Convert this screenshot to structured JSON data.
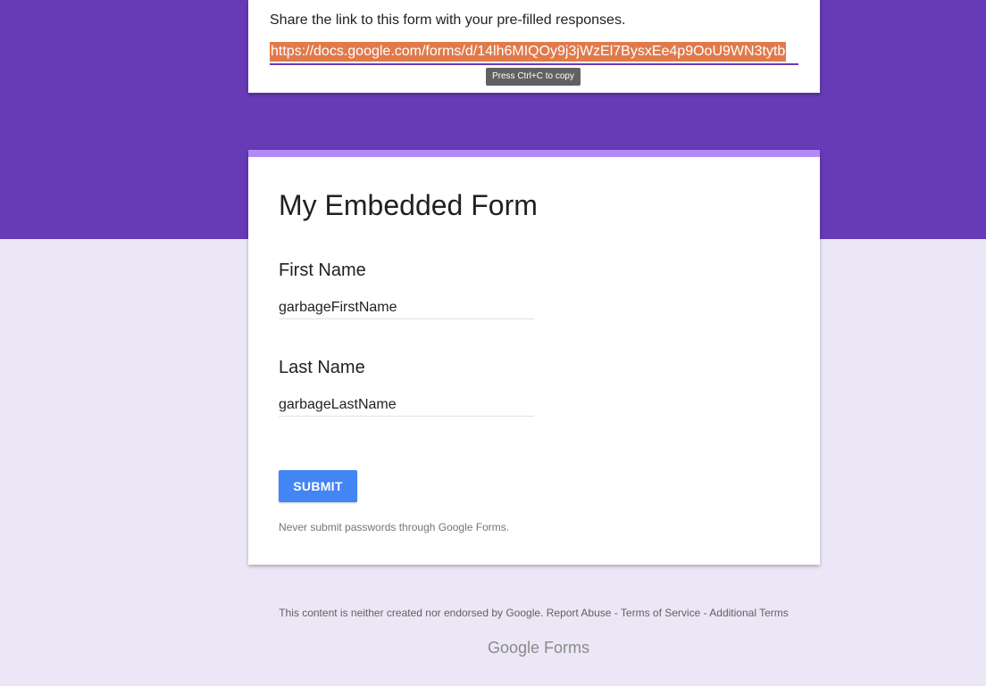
{
  "share": {
    "instruction": "Share the link to this form with your pre-filled responses.",
    "link": "https://docs.google.com/forms/d/14lh6MIQOy9j3jWzEl7BysxEe4p9OoU9WN3tytb",
    "tooltip": "Press Ctrl+C to copy"
  },
  "form": {
    "title": "My Embedded Form",
    "questions": [
      {
        "label": "First Name",
        "value": "garbageFirstName"
      },
      {
        "label": "Last Name",
        "value": "garbageLastName"
      }
    ],
    "submit_label": "SUBMIT",
    "warning": "Never submit passwords through Google Forms."
  },
  "footer": {
    "disclaimer": "This content is neither created nor endorsed by Google.",
    "links": [
      "Report Abuse",
      "Terms of Service",
      "Additional Terms"
    ],
    "separator": " - "
  },
  "brand": {
    "name": "Google Forms"
  },
  "colors": {
    "header_band": "#673ab7",
    "page_background": "#ece7f6",
    "accent_bar": "#b388f7",
    "submit_button": "#4285f4",
    "link_highlight": "#e07a4b"
  }
}
